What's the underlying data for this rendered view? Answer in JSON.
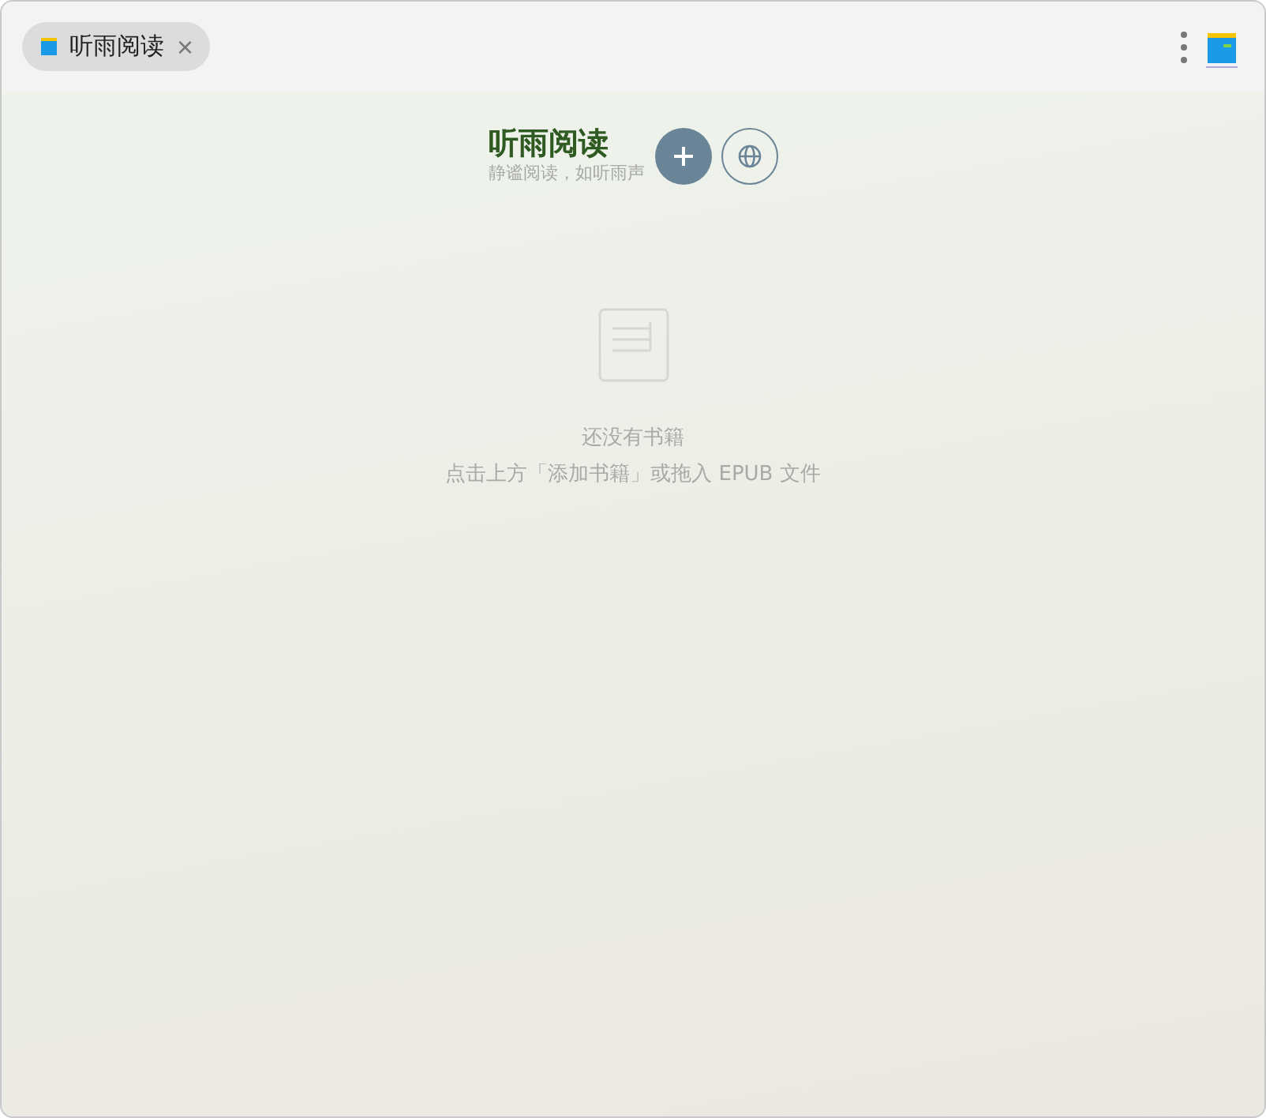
{
  "tab": {
    "label": "听雨阅读",
    "close": "×"
  },
  "header": {
    "title": "听雨阅读",
    "subtitle": "静谧阅读，如听雨声"
  },
  "empty": {
    "title": "还没有书籍",
    "hint": "点击上方「添加书籍」或拖入 EPUB 文件"
  }
}
